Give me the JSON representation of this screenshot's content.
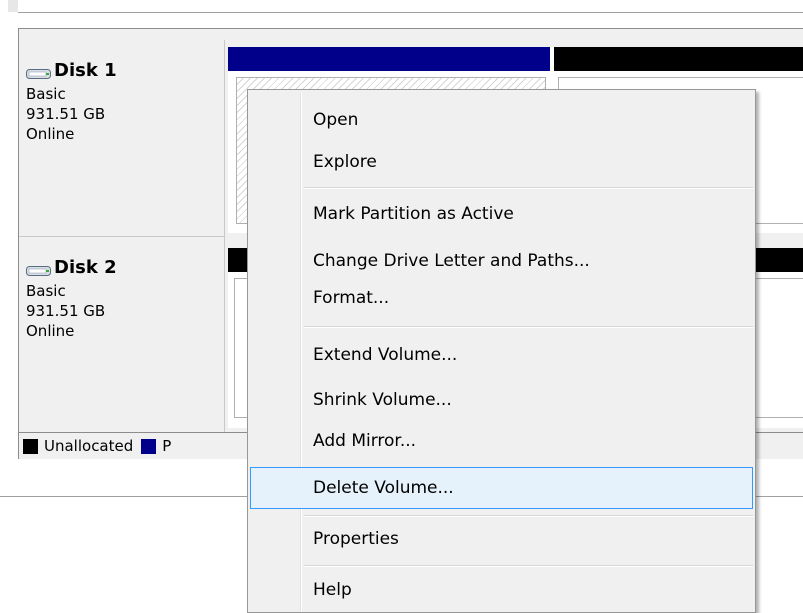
{
  "disks": [
    {
      "name": "Disk 1",
      "type": "Basic",
      "size": "931.51 GB",
      "status": "Online"
    },
    {
      "name": "Disk 2",
      "type": "Basic",
      "size": "931.51 GB",
      "status": "Online"
    }
  ],
  "legend": {
    "unallocated": "Unallocated",
    "primary_partial": "P"
  },
  "colors": {
    "primary_partition": "#00008b",
    "unallocated": "#000000",
    "menu_highlight_bg": "#e5f1fb",
    "menu_highlight_border": "#3399ff"
  },
  "context_menu": {
    "items": [
      {
        "label": "Open"
      },
      {
        "label": "Explore"
      },
      {
        "label": "Mark Partition as Active"
      },
      {
        "label": "Change Drive Letter and Paths..."
      },
      {
        "label": "Format..."
      },
      {
        "label": "Extend Volume..."
      },
      {
        "label": "Shrink Volume..."
      },
      {
        "label": "Add Mirror..."
      },
      {
        "label": "Delete Volume...",
        "highlighted": true
      },
      {
        "label": "Properties"
      },
      {
        "label": "Help"
      }
    ]
  },
  "icons": {
    "disk": "disk-drive-icon"
  }
}
